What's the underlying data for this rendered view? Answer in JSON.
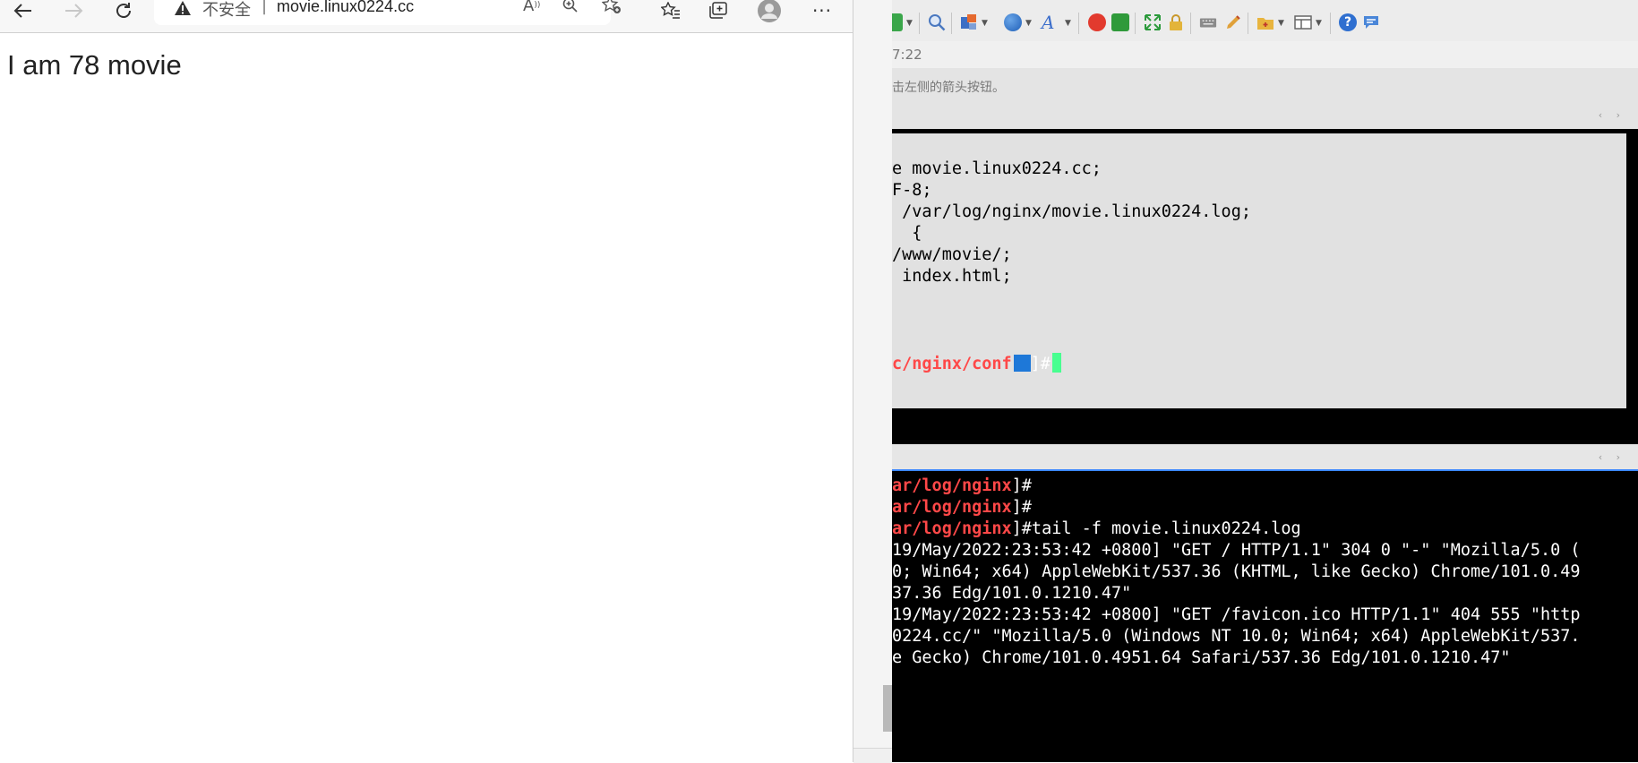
{
  "browser": {
    "address": {
      "not_secure": "不安全",
      "separator": "|",
      "url": "movie.linux0224.cc"
    },
    "page_text": "I am 78 movie"
  },
  "terminal_app": {
    "time_fragment": "7:22",
    "hint": "击左侧的箭头按钮。",
    "pane_arrows": "‹ ›",
    "config_lines": [
      "e movie.linux0224.cc;",
      "F-8;",
      " /var/log/nginx/movie.linux0224.log;",
      "  {",
      "/www/movie/;",
      " index.html;"
    ],
    "top_prompt": {
      "path": "c/nginx/conf",
      "suffix": "]#"
    },
    "bottom_lines": [
      {
        "path": "ar/log/nginx",
        "rest": "]#"
      },
      {
        "path": "ar/log/nginx",
        "rest": "]#"
      },
      {
        "path": "ar/log/nginx",
        "rest": "]#tail -f movie.linux0224.log"
      },
      {
        "path": "",
        "rest": "19/May/2022:23:53:42 +0800] \"GET / HTTP/1.1\" 304 0 \"-\" \"Mozilla/5.0 ("
      },
      {
        "path": "",
        "rest": "0; Win64; x64) AppleWebKit/537.36 (KHTML, like Gecko) Chrome/101.0.49"
      },
      {
        "path": "",
        "rest": "37.36 Edg/101.0.1210.47\""
      },
      {
        "path": "",
        "rest": "19/May/2022:23:53:42 +0800] \"GET /favicon.ico HTTP/1.1\" 404 555 \"http"
      },
      {
        "path": "",
        "rest": "0224.cc/\" \"Mozilla/5.0 (Windows NT 10.0; Win64; x64) AppleWebKit/537."
      },
      {
        "path": "",
        "rest": "e Gecko) Chrome/101.0.4951.64 Safari/537.36 Edg/101.0.1210.47\""
      }
    ]
  },
  "colors": {
    "prompt_path": "#ff4848",
    "cursor": "#48ff90",
    "splitter_accent": "#3a86ff"
  }
}
